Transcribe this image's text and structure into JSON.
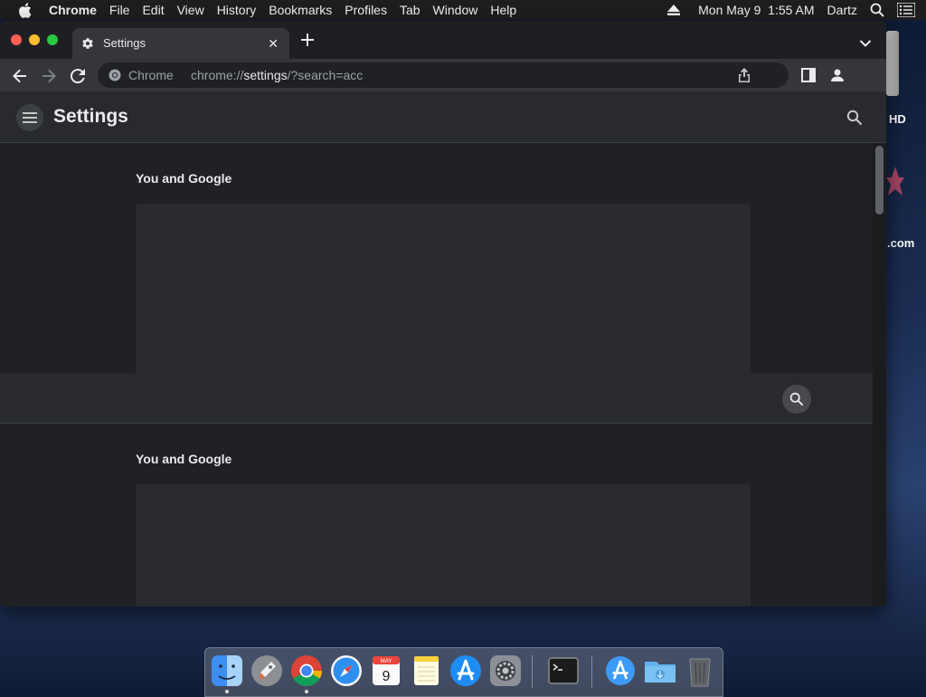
{
  "menubar": {
    "app_name": "Chrome",
    "items": [
      "File",
      "Edit",
      "View",
      "History",
      "Bookmarks",
      "Profiles",
      "Tab",
      "Window",
      "Help"
    ],
    "clock": "Mon May 9  1:55 AM",
    "user": "Dartz"
  },
  "desktop": {
    "drive_label": "HD",
    "file_label": ".com"
  },
  "tab": {
    "title": "Settings",
    "close_glyph": "✕",
    "new_tab_glyph": "+"
  },
  "omnibox": {
    "scheme_label": "Chrome",
    "url_prefix": "chrome://",
    "url_host": "settings",
    "url_suffix": "/?search=acc"
  },
  "settings": {
    "title": "Settings",
    "section1_title": "You and Google",
    "section2_title": "You and Google"
  },
  "calendar": {
    "month": "MAY",
    "day": "9"
  },
  "colors": {
    "window_bg": "#202124",
    "toolbar_bg": "#35363a",
    "card_bg": "#292a2d",
    "traffic_red": "#ff5f57",
    "traffic_yellow": "#febc2e",
    "traffic_green": "#28c840"
  },
  "icons": {
    "apple": "apple-icon",
    "spotlight": "search-icon",
    "control_center": "list-icon",
    "tab_gear": "gear-icon",
    "back": "back-arrow-icon",
    "forward": "forward-arrow-icon",
    "reload": "reload-icon",
    "share": "share-icon",
    "side_panel": "side-panel-icon",
    "profile": "profile-icon",
    "menu": "hamburger-icon",
    "settings_search": "search-icon"
  },
  "dock": {
    "apps": [
      "Finder",
      "Launchpad",
      "Google Chrome",
      "Safari",
      "Calendar",
      "Notes",
      "App Store",
      "System Preferences",
      "Terminal",
      "Applications",
      "Downloads",
      "Trash"
    ]
  }
}
